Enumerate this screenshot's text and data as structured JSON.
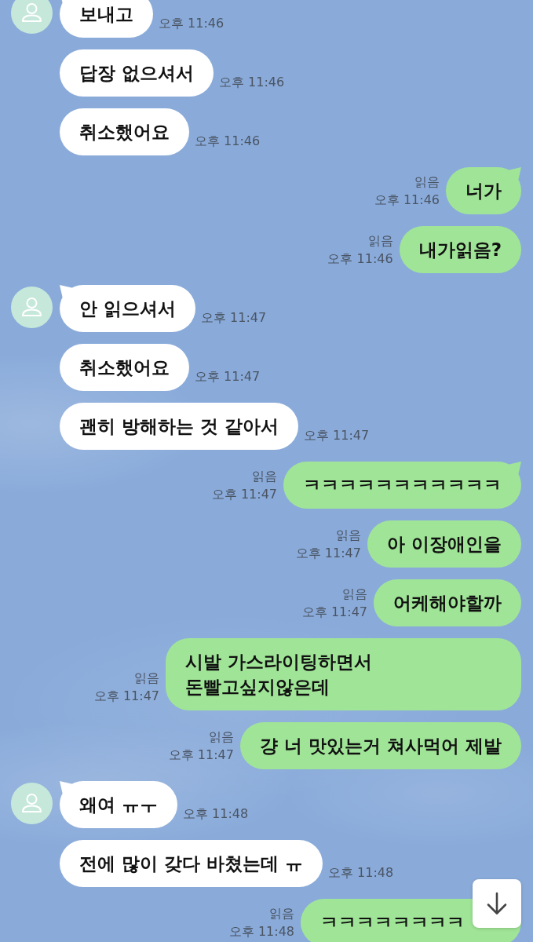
{
  "messages": [
    {
      "kind": "received",
      "avatar": true,
      "tail": true,
      "text": "보내고",
      "time": "오후 11:46"
    },
    {
      "kind": "received",
      "avatar": false,
      "tail": false,
      "text": "답장 없으셔서",
      "time": "오후 11:46"
    },
    {
      "kind": "received",
      "avatar": false,
      "tail": false,
      "text": "취소했어요",
      "time": "오후 11:46"
    },
    {
      "kind": "sent",
      "tail": true,
      "text": "너가",
      "read": "읽음",
      "time": "오후 11:46"
    },
    {
      "kind": "sent",
      "tail": false,
      "text": "내가읽음?",
      "read": "읽음",
      "time": "오후 11:46"
    },
    {
      "kind": "received",
      "avatar": true,
      "tail": true,
      "text": "안 읽으셔서",
      "time": "오후 11:47"
    },
    {
      "kind": "received",
      "avatar": false,
      "tail": false,
      "text": "취소했어요",
      "time": "오후 11:47"
    },
    {
      "kind": "received",
      "avatar": false,
      "tail": false,
      "text": "괜히 방해하는 것 같아서",
      "time": "오후 11:47"
    },
    {
      "kind": "sent",
      "tail": true,
      "text": "ㅋㅋㅋㅋㅋㅋㅋㅋㅋㅋㅋ",
      "read": "읽음",
      "time": "오후 11:47"
    },
    {
      "kind": "sent",
      "tail": false,
      "text": "아 이장애인을",
      "read": "읽음",
      "time": "오후 11:47"
    },
    {
      "kind": "sent",
      "tail": false,
      "text": "어케해야할까",
      "read": "읽음",
      "time": "오후 11:47"
    },
    {
      "kind": "sent",
      "tail": false,
      "text": "시발 가스라이팅하면서 돈빨고싶지않은데",
      "read": "읽음",
      "time": "오후 11:47"
    },
    {
      "kind": "sent",
      "tail": false,
      "text": "걍 너 맛있는거 쳐사먹어 제발",
      "read": "읽음",
      "time": "오후 11:47"
    },
    {
      "kind": "received",
      "avatar": true,
      "tail": true,
      "text": "왜여 ㅠㅜ",
      "time": "오후 11:48"
    },
    {
      "kind": "received",
      "avatar": false,
      "tail": false,
      "text": "전에 많이 갖다 바쳤는데 ㅠ",
      "time": "오후 11:48"
    },
    {
      "kind": "sent",
      "tail": true,
      "under_button": true,
      "text": "ㅋㅋㅋㅋㅋㅋㅋㅋ",
      "read": "읽음",
      "time": "오후 11:48"
    }
  ]
}
